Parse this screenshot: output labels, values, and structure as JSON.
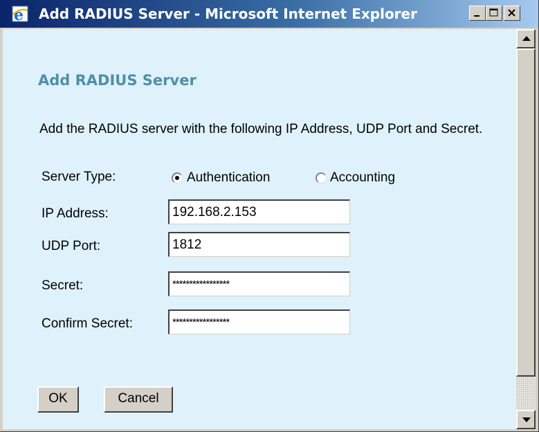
{
  "window": {
    "title": "Add RADIUS Server - Microsoft Internet Explorer",
    "icon": "internet-explorer-icon"
  },
  "form": {
    "heading": "Add RADIUS Server",
    "intro": "Add the RADIUS server with the following IP Address, UDP Port and Secret.",
    "server_type": {
      "label": "Server Type:",
      "options": [
        {
          "label": "Authentication",
          "selected": true
        },
        {
          "label": "Accounting",
          "selected": false
        }
      ]
    },
    "ip_address": {
      "label": "IP Address:",
      "value": "192.168.2.153"
    },
    "udp_port": {
      "label": "UDP Port:",
      "value": "1812"
    },
    "secret": {
      "label": "Secret:",
      "value": "*****************"
    },
    "confirm_secret": {
      "label": "Confirm Secret:",
      "value": "*****************"
    }
  },
  "buttons": {
    "ok": "OK",
    "cancel": "Cancel"
  },
  "colors": {
    "content_background": "#dff1fb",
    "heading": "#4f8fa6",
    "titlebar_start": "#0a246a",
    "titlebar_end": "#a6caf0"
  }
}
